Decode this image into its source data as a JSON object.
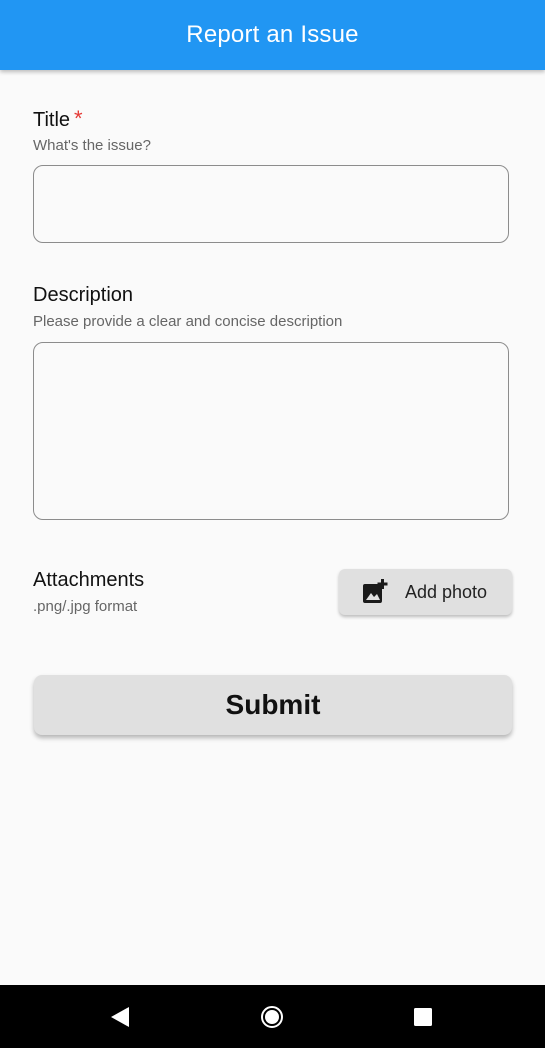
{
  "appbar": {
    "title": "Report an Issue",
    "color": "#2196f3"
  },
  "form": {
    "title": {
      "label": "Title",
      "required_marker": "*",
      "hint": "What's the issue?",
      "value": ""
    },
    "description": {
      "label": "Description",
      "hint": "Please provide a clear and concise description",
      "value": ""
    },
    "attachments": {
      "label": "Attachments",
      "hint": ".png/.jpg format",
      "add_photo_label": "Add photo",
      "add_photo_icon": "add-photo-icon"
    },
    "submit_label": "Submit"
  },
  "system_nav": {
    "back_icon": "back-triangle-icon",
    "home_icon": "home-circle-icon",
    "recents_icon": "recents-square-icon"
  }
}
